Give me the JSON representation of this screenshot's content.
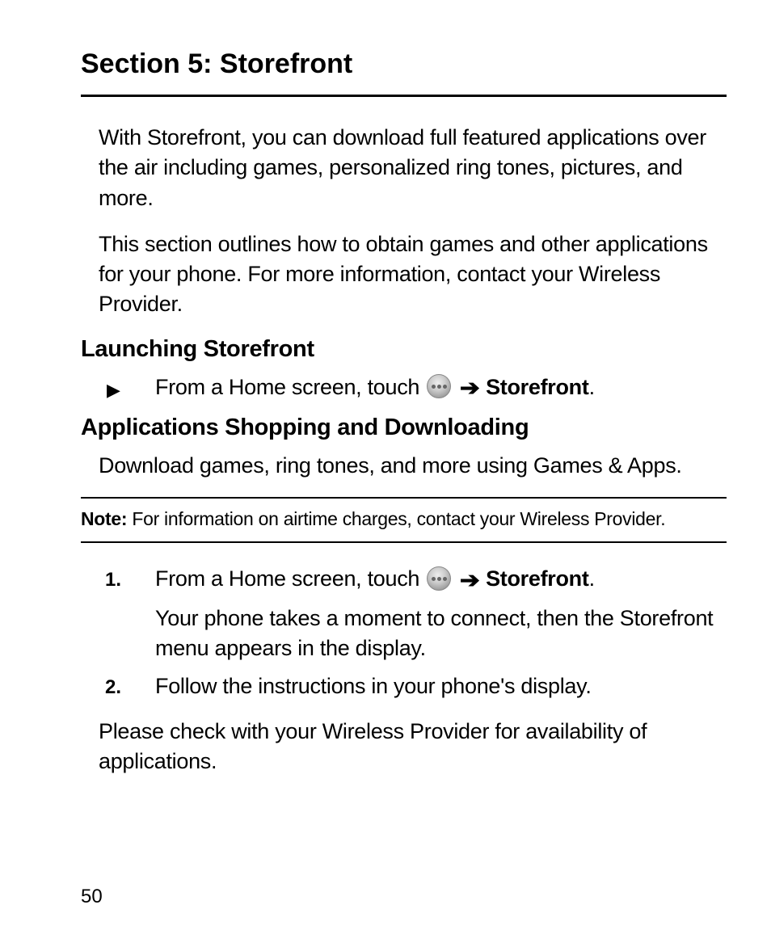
{
  "title": "Section 5: Storefront",
  "intro1": "With Storefront, you can download full featured applications over the air including games, personalized ring tones, pictures, and more.",
  "intro2": "This section outlines how to obtain games and other applications for your phone. For more information, contact your Wireless Provider.",
  "sub1": "Launching Storefront",
  "launch_prefix": "From a Home screen, touch ",
  "storefront_label": "Storefront",
  "period": ".",
  "sub2": "Applications Shopping and Downloading",
  "apps_desc": "Download games, ring tones, and more using Games & Apps.",
  "note_label": "Note:",
  "note_text": " For information on airtime charges, contact your Wireless Provider.",
  "step1_num": "1.",
  "step1_prefix": "From a Home screen, touch ",
  "step1_after": "Your phone takes a moment to connect, then the Storefront menu appears in the display.",
  "step2_num": "2.",
  "step2_text": "Follow the instructions in your phone's display.",
  "closing": "Please check with your Wireless Provider for availability of applications.",
  "page_number": "50",
  "arrow": "➔",
  "bullet": "▶"
}
